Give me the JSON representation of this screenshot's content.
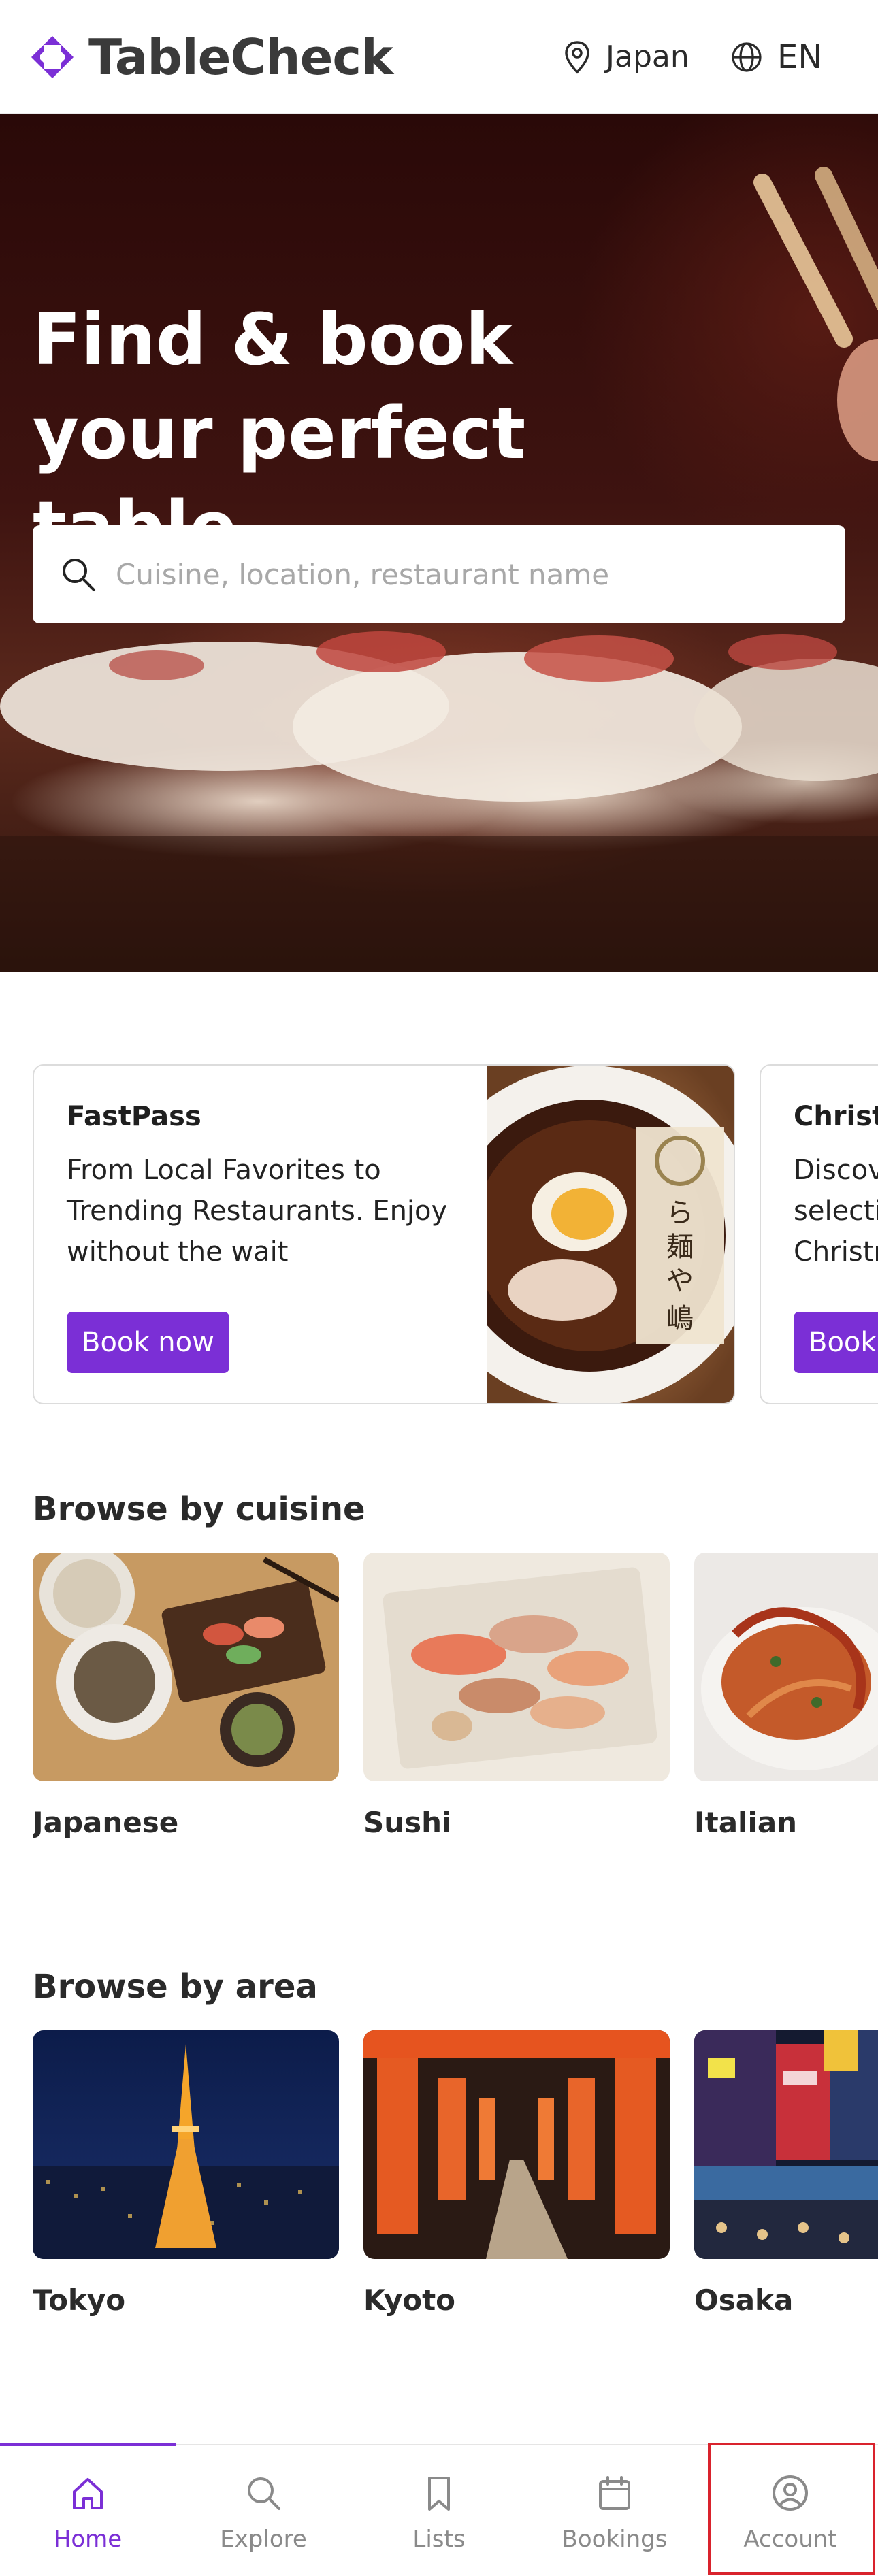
{
  "header": {
    "brand": "TableCheck",
    "country": "Japan",
    "language": "EN",
    "icons": {
      "logo": "tablecheck-logo-icon",
      "location": "map-pin-icon",
      "language": "globe-icon"
    }
  },
  "hero": {
    "title": "Find & book your perfect table.",
    "search_placeholder": "Cuisine, location, restaurant name"
  },
  "promos": [
    {
      "title": "FastPass",
      "description": "From Local Favorites to Trending Restaurants. Enjoy without the wait",
      "button": "Book now"
    },
    {
      "title": "Christmas",
      "description": "Discover a selection of Christmas",
      "button": "Book now"
    }
  ],
  "cuisine_section": {
    "title": "Browse by cuisine",
    "items": [
      {
        "label": "Japanese"
      },
      {
        "label": "Sushi"
      },
      {
        "label": "Italian"
      }
    ]
  },
  "area_section": {
    "title": "Browse by area",
    "items": [
      {
        "label": "Tokyo"
      },
      {
        "label": "Kyoto"
      },
      {
        "label": "Osaka"
      }
    ]
  },
  "bottom_nav": {
    "items": [
      {
        "label": "Home",
        "icon": "home-icon",
        "active": true
      },
      {
        "label": "Explore",
        "icon": "search-icon",
        "active": false
      },
      {
        "label": "Lists",
        "icon": "bookmark-icon",
        "active": false
      },
      {
        "label": "Bookings",
        "icon": "calendar-icon",
        "active": false
      },
      {
        "label": "Account",
        "icon": "user-circle-icon",
        "active": false
      }
    ]
  },
  "colors": {
    "brand": "#7b2fd6",
    "highlight": "#d9232d",
    "text": "#2a2a2a"
  }
}
